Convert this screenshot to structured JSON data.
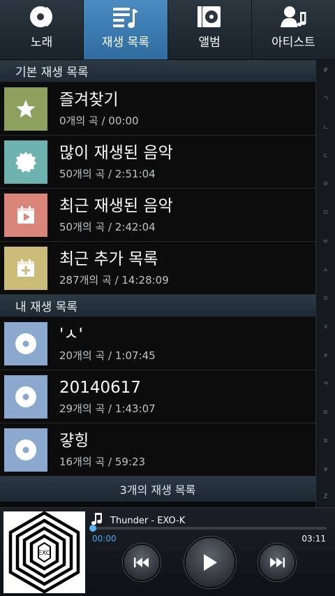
{
  "tabs": [
    {
      "label": "노래",
      "icon": "song-disc-icon",
      "active": false
    },
    {
      "label": "재생 목록",
      "icon": "playlist-icon",
      "active": true
    },
    {
      "label": "앨범",
      "icon": "album-icon",
      "active": false
    },
    {
      "label": "아티스트",
      "icon": "artist-icon",
      "active": false
    }
  ],
  "sections": {
    "basic": "기본 재생 목록",
    "mine": "내 재생 목록"
  },
  "basic_playlists": [
    {
      "title": "즐겨찾기",
      "sub": "0개의 곡 / 00:00",
      "icon": "star-icon",
      "color": "#8ea05e"
    },
    {
      "title": "많이 재생된 음악",
      "sub": "50개의 곡 / 2:51:04",
      "icon": "badge-icon",
      "color": "#6fb3b0"
    },
    {
      "title": "최근 재생된 음악",
      "sub": "50개의 곡 / 2:42:04",
      "icon": "calendar-play-icon",
      "color": "#d9857a"
    },
    {
      "title": "최근 추가 목록",
      "sub": "287개의 곡 / 14:28:09",
      "icon": "calendar-add-icon",
      "color": "#cbbd79"
    }
  ],
  "my_playlists": [
    {
      "title": "'ㅅ'",
      "sub": "20개의 곡 / 1:07:45",
      "icon": "disc-icon",
      "color": "#8ba8cf"
    },
    {
      "title": "20140617",
      "sub": "29개의 곡 / 1:43:07",
      "icon": "disc-icon",
      "color": "#8ba8cf"
    },
    {
      "title": "걓힝",
      "sub": "16개의 곡 / 59:23",
      "icon": "disc-icon",
      "color": "#8ba8cf"
    }
  ],
  "footer": "3개의 재생 목록",
  "index_letters": [
    "#",
    "ㄱ",
    "ㄴ",
    "ㄷ",
    "ㄹ",
    "ㅁ",
    "ㅂ",
    "ㅅ",
    "ㅇ",
    "ㅈ",
    "ㅊ",
    "ㅋ",
    "ㅌ",
    "ㅍ",
    "ㅎ",
    "Z"
  ],
  "player": {
    "song": "Thunder - EXO-K",
    "current": "00:00",
    "total": "03:11",
    "progress": 0.0
  },
  "colors": {
    "active_tab": "#3f80b5",
    "accent": "#3a9be6"
  }
}
